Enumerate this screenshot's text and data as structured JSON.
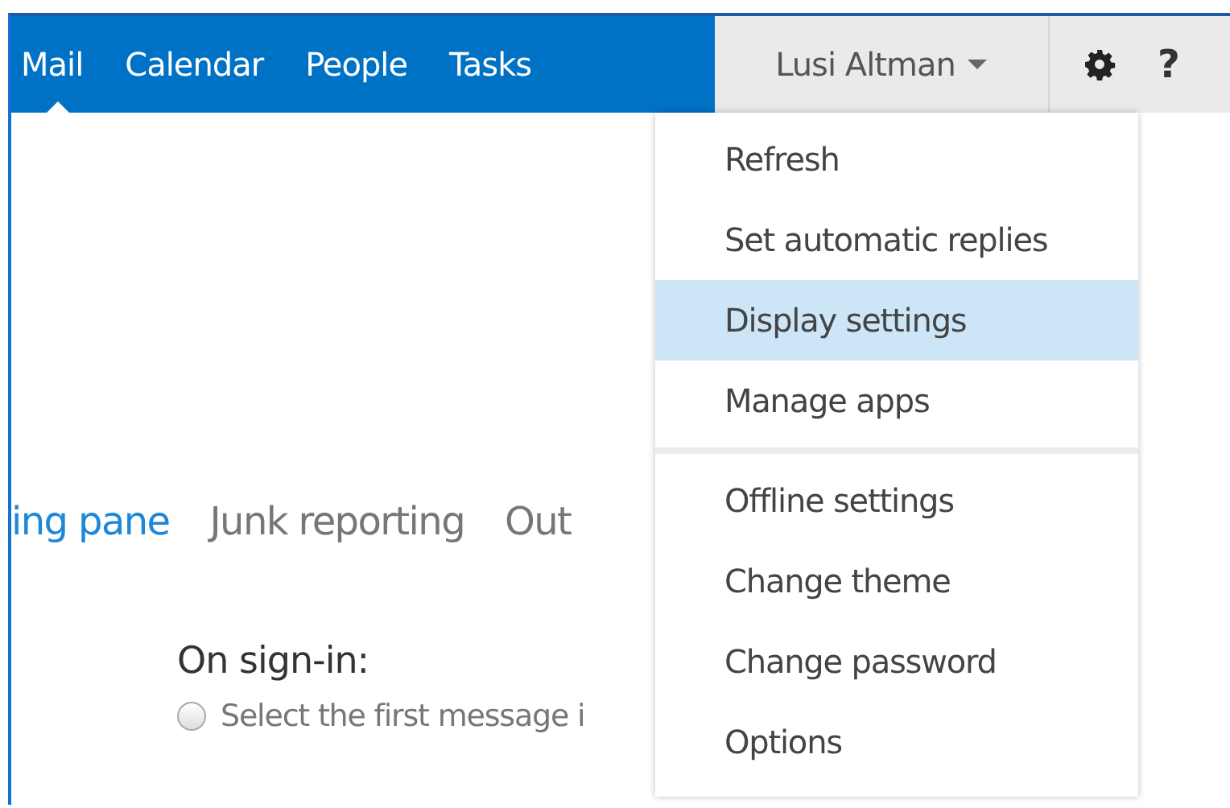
{
  "nav_tabs": [
    {
      "label": "Mail",
      "selected": true
    },
    {
      "label": "Calendar",
      "selected": false
    },
    {
      "label": "People",
      "selected": false
    },
    {
      "label": "Tasks",
      "selected": false
    }
  ],
  "user": {
    "label": "Lusi Altman"
  },
  "help": {
    "label": "?"
  },
  "settings_tabs": [
    {
      "label": "ing pane",
      "selected": true
    },
    {
      "label": "Junk reporting",
      "selected": false
    },
    {
      "label": "Out",
      "selected": false
    }
  ],
  "sign_in": {
    "heading": "On sign-in:",
    "options": [
      {
        "label": "Select the first message i",
        "selected": false
      }
    ]
  },
  "menu": {
    "sections": [
      {
        "items": [
          {
            "label": "Refresh",
            "selected": false
          },
          {
            "label": "Set automatic replies",
            "selected": false
          },
          {
            "label": "Display settings",
            "selected": true
          },
          {
            "label": "Manage apps",
            "selected": false
          }
        ]
      },
      {
        "items": [
          {
            "label": "Offline settings",
            "selected": false
          },
          {
            "label": "Change theme",
            "selected": false
          },
          {
            "label": "Change password",
            "selected": false
          },
          {
            "label": "Options",
            "selected": false
          }
        ]
      }
    ]
  }
}
